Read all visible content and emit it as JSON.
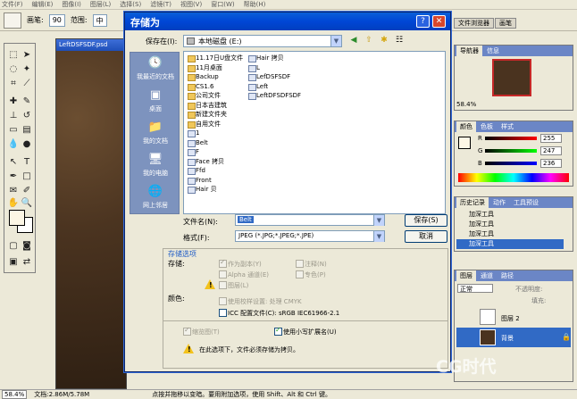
{
  "menubar": {
    "items": [
      "文件(F)",
      "编辑(E)",
      "图像(I)",
      "图层(L)",
      "选择(S)",
      "滤镜(T)",
      "视图(V)",
      "窗口(W)",
      "帮助(H)"
    ]
  },
  "options_bar": {
    "brush_label": "画笔:",
    "brush_size": "90",
    "range_label": "范围:",
    "range_value": "中"
  },
  "dock_tabs": [
    "文件浏览器",
    "画笔"
  ],
  "document": {
    "title": "LeftDSFSDF.psd"
  },
  "status_bar": {
    "zoom": "58.4%",
    "doc_info": "文档:2.86M/5.78M",
    "hint": "点按并拖移以变暗。要用附加选项，使用 Shift、Alt 和 Ctrl 键。"
  },
  "dialog": {
    "title": "存储为",
    "save_in_label": "保存在(I):",
    "save_in_value": "本地磁盘 (E:)",
    "places": [
      {
        "label": "我最近的文档",
        "icon": "recent-documents-icon"
      },
      {
        "label": "桌面",
        "icon": "desktop-icon"
      },
      {
        "label": "我的文档",
        "icon": "my-documents-icon"
      },
      {
        "label": "我的电脑",
        "icon": "my-computer-icon"
      },
      {
        "label": "网上邻居",
        "icon": "network-places-icon"
      }
    ],
    "files_col1": [
      {
        "name": "11.17日U盘文件",
        "type": "folder"
      },
      {
        "name": "11月桌面",
        "type": "folder"
      },
      {
        "name": "Backup",
        "type": "folder"
      },
      {
        "name": "CS1.6",
        "type": "folder"
      },
      {
        "name": "公司文件",
        "type": "folder"
      },
      {
        "name": "日本吉建筑",
        "type": "folder"
      },
      {
        "name": "新建文件夹",
        "type": "folder"
      },
      {
        "name": "自用文件",
        "type": "folder"
      },
      {
        "name": "1",
        "type": "file"
      },
      {
        "name": "Belt",
        "type": "file"
      },
      {
        "name": "F",
        "type": "file"
      },
      {
        "name": "Face 拷贝",
        "type": "file"
      },
      {
        "name": "Ffd",
        "type": "file"
      },
      {
        "name": "Front",
        "type": "file"
      },
      {
        "name": "Hair 贝",
        "type": "file"
      }
    ],
    "files_col2": [
      {
        "name": "Hair 拷贝",
        "type": "file"
      },
      {
        "name": "L",
        "type": "file"
      },
      {
        "name": "LefDSFSDF",
        "type": "file"
      },
      {
        "name": "Left",
        "type": "file"
      },
      {
        "name": "LeftDFSDFSDF",
        "type": "file"
      }
    ],
    "filename_label": "文件名(N):",
    "filename_value": "Belt",
    "format_label": "格式(F):",
    "format_value": "JPEG (*.JPG;*.JPEG;*.JPE)",
    "save_button": "保存(S)",
    "cancel_button": "取消",
    "options": {
      "header": "存储选项",
      "save_label": "存储:",
      "as_copy": "作为副本(Y)",
      "alpha": "Alpha 通道(E)",
      "layers": "图层(L)",
      "annotations": "注释(N)",
      "spot": "专色(P)",
      "color_label": "颜色:",
      "proof": "使用校样设置: 处理 CMYK",
      "icc": "ICC 配置文件(C): sRGB IEC61966-2.1",
      "thumbnail": "缩览图(T)",
      "lowercase": "使用小写扩展名(U)",
      "warning": "在此选项下，文件必须存储为拷贝。"
    }
  },
  "panels": {
    "navigator": {
      "tabs": [
        "导航器",
        "信息"
      ],
      "zoom": "58.4%"
    },
    "color": {
      "tabs": [
        "颜色",
        "色板",
        "样式"
      ],
      "r_label": "R",
      "g_label": "G",
      "b_label": "B",
      "r": "255",
      "g": "247",
      "b": "236"
    },
    "history": {
      "tabs": [
        "历史记录",
        "动作",
        "工具预设"
      ],
      "items": [
        "加深工具",
        "加深工具",
        "加深工具",
        "加深工具"
      ]
    },
    "layers": {
      "tabs": [
        "图层",
        "通道",
        "路径"
      ],
      "blend_mode": "正常",
      "opacity_label": "不透明度:",
      "fill_label": "填充:",
      "layer_items": [
        "图层 2",
        "背景"
      ]
    }
  },
  "watermark": "CG时代",
  "colors": {
    "titlebar": "#0046d5",
    "dialog_bg": "#ece9d8",
    "accent_blue": "#316ac5",
    "foreground_swatch": "#fcf6e5"
  }
}
